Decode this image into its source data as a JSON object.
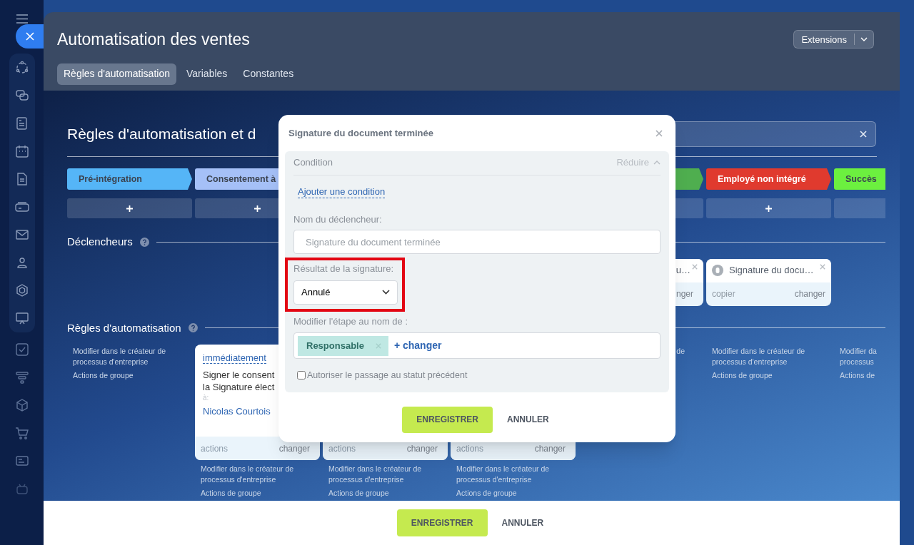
{
  "header": {
    "title": "Automatisation des ventes",
    "extensions_button": "Extensions",
    "tabs": [
      {
        "label": "Règles d'automatisation",
        "selected": true
      },
      {
        "label": "Variables",
        "selected": false
      },
      {
        "label": "Constantes",
        "selected": false
      }
    ]
  },
  "heading": "Règles d'automatisation et d",
  "stages": [
    {
      "kind": "stage",
      "label": "Pré-intégration",
      "color": "#55b5f7"
    },
    {
      "kind": "stage",
      "label": "Consentement à",
      "color": "#a5c0f7"
    },
    {
      "kind": "covered"
    },
    {
      "kind": "covered"
    },
    {
      "kind": "stage",
      "color": "#4fae4f"
    },
    {
      "kind": "stage",
      "label": "Employé non intégré",
      "color": "#e03a2e"
    },
    {
      "kind": "stage",
      "label": "Succès",
      "color": "#6cf03f"
    }
  ],
  "add_buttons": [
    {
      "kind": "add"
    },
    {
      "kind": "add"
    },
    {
      "kind": "covered"
    },
    {
      "kind": "covered"
    },
    {
      "kind": "blank"
    },
    {
      "kind": "add"
    },
    {
      "kind": "blank"
    }
  ],
  "triggers_section": {
    "title": "Déclencheurs"
  },
  "triggers": [
    {
      "kind": "empty"
    },
    {
      "kind": "empty"
    },
    {
      "kind": "empty"
    },
    {
      "kind": "empty"
    },
    {
      "kind": "clipped",
      "title": "u…",
      "action": "nger"
    },
    {
      "kind": "card",
      "title": "Signature du docu…",
      "copy": "copier",
      "action": "changer"
    },
    {
      "kind": "empty"
    }
  ],
  "robots_section": {
    "title": "Règles d'automatisation"
  },
  "robots": [
    {
      "kind": "links",
      "links": [
        [
          "Modifier dans le créateur de",
          "processus d'entreprise"
        ],
        [
          "Actions de groupe"
        ]
      ]
    },
    {
      "kind": "card",
      "delay": "immédiatement",
      "lines": [
        "Signer le consent",
        "la Signature élect"
      ],
      "to_label": "à:",
      "assignee": "Nicolas Courtois",
      "footer_left": "actions",
      "footer_right": "changer",
      "links": [
        [
          "Modifier dans le créateur de",
          "processus d'entreprise"
        ],
        [
          "Actions de groupe"
        ]
      ]
    },
    {
      "kind": "card",
      "footer_left": "actions",
      "footer_right": "changer",
      "links": [
        [
          "Modifier dans le créateur de",
          "processus d'entreprise"
        ],
        [
          "Actions de groupe"
        ]
      ]
    },
    {
      "kind": "card",
      "footer_left": "actions",
      "footer_right": "changer",
      "links": [
        [
          "Modifier dans le créateur de",
          "processus d'entreprise"
        ],
        [
          "Actions de groupe"
        ]
      ]
    },
    {
      "kind": "clipped",
      "links": [
        [
          "de"
        ]
      ]
    },
    {
      "kind": "links",
      "links": [
        [
          "Modifier dans le créateur de",
          "processus d'entreprise"
        ],
        [
          "Actions de groupe"
        ]
      ]
    },
    {
      "kind": "links",
      "links": [
        [
          "Modifier da",
          "processus"
        ],
        [
          "Actions de"
        ]
      ]
    }
  ],
  "dialog": {
    "title": "Signature du document terminée",
    "condition": {
      "title": "Condition",
      "collapse": "Réduire",
      "add_link": "Ajouter une condition"
    },
    "fields": [
      {
        "kind": "text",
        "label": "Nom du déclencheur:",
        "placeholder": "Signature du document terminée",
        "highlighted": false
      },
      {
        "kind": "select",
        "label": "Résultat de la signature:",
        "value": "Annulé",
        "highlighted": true
      },
      {
        "kind": "users",
        "label": "Modifier l'étape au nom de :",
        "tags": [
          "Responsable"
        ],
        "add_link": "+ changer",
        "highlighted": false
      },
      {
        "kind": "checkbox",
        "label": "Autoriser le passage au statut précédent",
        "checked": false,
        "highlighted": false
      }
    ],
    "save": "ENREGISTRER",
    "cancel": "ANNULER"
  },
  "footer": {
    "save": "ENREGISTRER",
    "cancel": "ANNULER"
  }
}
